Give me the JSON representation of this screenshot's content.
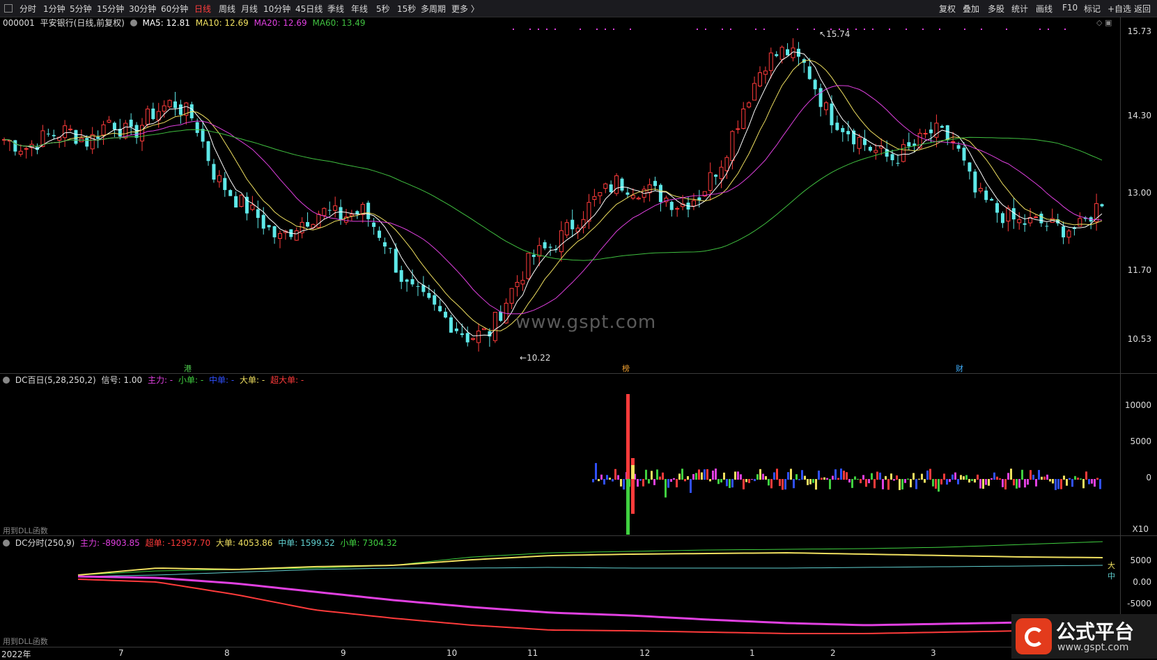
{
  "toolbar": {
    "items": [
      "分时",
      "1分钟",
      "5分钟",
      "15分钟",
      "30分钟",
      "60分钟",
      "日线",
      "周线",
      "月线",
      "10分钟",
      "45日线",
      "季线",
      "年线",
      "5秒",
      "15秒",
      "多周期",
      "更多 〉"
    ],
    "active": "日线",
    "right": [
      "复权",
      "叠加",
      "多股",
      "统计",
      "画线",
      "F10",
      "标记",
      "+自选",
      "返回"
    ]
  },
  "main": {
    "code": "000001",
    "name": "平安银行(日线,前复权)",
    "ma5": "MA5: 12.81",
    "ma10": "MA10: 12.69",
    "ma20": "MA20: 12.69",
    "ma60": "MA60: 13.49",
    "high_label": "15.74",
    "low_label": "10.22",
    "y_ticks": [
      "15.73",
      "14.30",
      "13.00",
      "11.70",
      "10.53"
    ],
    "markers": [
      "港",
      "榜",
      "财"
    ],
    "colors": {
      "up": "#ff3b3b",
      "down": "#5ee8e8",
      "ma5": "#ffffff",
      "ma10": "#f0e060",
      "ma20": "#e040e0",
      "ma60": "#40c040"
    }
  },
  "panel1": {
    "title": "DC百日(5,28,250,2)",
    "signal": "信号: 1.00",
    "zhuli": "主力: -",
    "xiaodan": "小单: -",
    "zhongdan": "中单: -",
    "dadan": "大单: -",
    "chaoda": "超大单: -",
    "y_ticks": [
      "10000",
      "5000",
      "0"
    ],
    "scale": "X10",
    "footer": "用到DLL函数"
  },
  "panel2": {
    "title": "DC分时(250,9)",
    "zhuli": "主力: -8903.85",
    "chaodan": "超单: -12957.70",
    "dadan": "大单: 4053.86",
    "zhongdan": "中单: 1599.52",
    "xiaodan": "小单: 7304.32",
    "y_ticks": [
      "5000",
      "0.00",
      "-5000"
    ],
    "footer": "用到DLL函数",
    "right_tags": [
      "大",
      "中"
    ]
  },
  "xaxis": {
    "labels": [
      "2022年",
      "7",
      "8",
      "9",
      "10",
      "11",
      "12",
      "1",
      "2",
      "3"
    ]
  },
  "watermark": "www.gspt.com",
  "logo": {
    "title": "公式平台",
    "url": "www.gspt.com"
  },
  "chart_data": {
    "type": "candlestick",
    "title": "000001 平安银行(日线,前复权)",
    "ma": {
      "MA5": 12.81,
      "MA10": 12.69,
      "MA20": 12.69,
      "MA60": 13.49
    },
    "y_ticks": [
      15.73,
      14.3,
      13.0,
      11.7,
      10.53
    ],
    "annotations": {
      "high": 15.74,
      "low": 10.22
    },
    "x_labels": [
      "2022年",
      "7",
      "8",
      "9",
      "10",
      "11",
      "12",
      "1",
      "2",
      "3"
    ],
    "close_path": [
      13.85,
      13.7,
      13.9,
      14.0,
      13.8,
      14.2,
      13.9,
      14.3,
      14.5,
      14.2,
      13.2,
      12.8,
      12.5,
      12.1,
      12.4,
      12.6,
      12.5,
      12.6,
      12.1,
      11.3,
      11.0,
      10.7,
      10.4,
      10.5,
      11.2,
      11.8,
      12.0,
      12.4,
      12.8,
      13.1,
      13.0,
      12.9,
      12.7,
      12.9,
      13.5,
      14.4,
      15.2,
      15.4,
      15.1,
      14.3,
      14.0,
      13.7,
      13.5,
      13.7,
      14.0,
      13.8,
      12.9,
      12.6,
      12.4,
      12.4,
      12.3,
      12.3,
      12.8
    ]
  }
}
